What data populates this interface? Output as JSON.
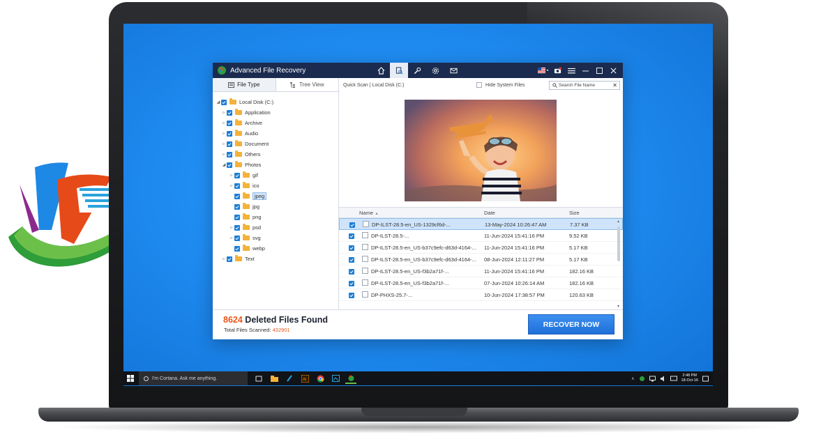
{
  "app": {
    "title": "Advanced File Recovery",
    "nav_icons": [
      "home-icon",
      "scan-icon",
      "tools-icon",
      "settings-icon",
      "mail-icon"
    ],
    "window_controls": [
      "menu-icon",
      "minimize-icon",
      "maximize-icon",
      "close-icon"
    ]
  },
  "tabs": [
    {
      "label": "File Type",
      "icon": "file-type-icon",
      "active": true
    },
    {
      "label": "Tree View",
      "icon": "tree-view-icon",
      "active": false
    }
  ],
  "tree": {
    "root": "Local Disk (C:)",
    "folders": [
      {
        "label": "Application",
        "level": 1,
        "expanded": false
      },
      {
        "label": "Archive",
        "level": 1,
        "expanded": false
      },
      {
        "label": "Audio",
        "level": 1,
        "expanded": false
      },
      {
        "label": "Document",
        "level": 1,
        "expanded": false
      },
      {
        "label": "Others",
        "level": 1,
        "expanded": false
      },
      {
        "label": "Photos",
        "level": 1,
        "expanded": true
      },
      {
        "label": "gif",
        "level": 2,
        "expanded": false
      },
      {
        "label": "ico",
        "level": 2,
        "expanded": false
      },
      {
        "label": "jpeg",
        "level": 2,
        "selected": true
      },
      {
        "label": "jpg",
        "level": 2
      },
      {
        "label": "png",
        "level": 2
      },
      {
        "label": "psd",
        "level": 2,
        "expanded": false
      },
      {
        "label": "svg",
        "level": 2,
        "expanded": false
      },
      {
        "label": "webp",
        "level": 2
      },
      {
        "label": "Text",
        "level": 1,
        "expanded": false
      }
    ]
  },
  "breadcrumb": "Quick Scan  |  Local Disk (C:)",
  "hide_system_files": {
    "label": "Hide System Files",
    "checked": false
  },
  "search": {
    "placeholder": "Search File Name"
  },
  "table": {
    "columns": [
      "Name",
      "Date",
      "Size"
    ],
    "rows": [
      {
        "name": "DP-ILST-28.5-en_US-1329cf6d-...",
        "date": "13-May-2024 10:26:47 AM",
        "size": "7.37 KB",
        "selected": true
      },
      {
        "name": "DP-ILST-28.5-...",
        "date": "11-Jun-2024 15:41:16 PM",
        "size": "9.52 KB"
      },
      {
        "name": "DP-ILST-28.5-en_US-b37c9efc-d63d-4164-...",
        "date": "11-Jun-2024 15:41:16 PM",
        "size": "5.17 KB"
      },
      {
        "name": "DP-ILST-28.5-en_US-b37c9efc-d63d-4164-...",
        "date": "08-Jun-2024 12:11:27 PM",
        "size": "5.17 KB"
      },
      {
        "name": "DP-ILST-28.5-en_US-f3b2a71f-...",
        "date": "11-Jun-2024 15:41:16 PM",
        "size": "182.16 KB"
      },
      {
        "name": "DP-ILST-28.5-en_US-f3b2a71f-...",
        "date": "07-Jun-2024 10:26:14 AM",
        "size": "182.16 KB"
      },
      {
        "name": "DP-PHXS-25.7-...",
        "date": "10-Jun-2024 17:38:57 PM",
        "size": "120.63 KB"
      }
    ]
  },
  "footer": {
    "found_count": "8624",
    "found_label": " Deleted Files Found",
    "scanned_label": "Total Files Scanned: ",
    "scanned_count": "432901",
    "recover_button": "RECOVER NOW"
  },
  "taskbar": {
    "cortana_placeholder": "I'm Cortana. Ask me anything.",
    "time": "2:48 PM",
    "date": "18-Oct-16"
  },
  "colors": {
    "accent": "#1c7ed6",
    "titlebar": "#1a2b4f",
    "highlight": "#e7561b",
    "screen": "#1f8cf2"
  }
}
